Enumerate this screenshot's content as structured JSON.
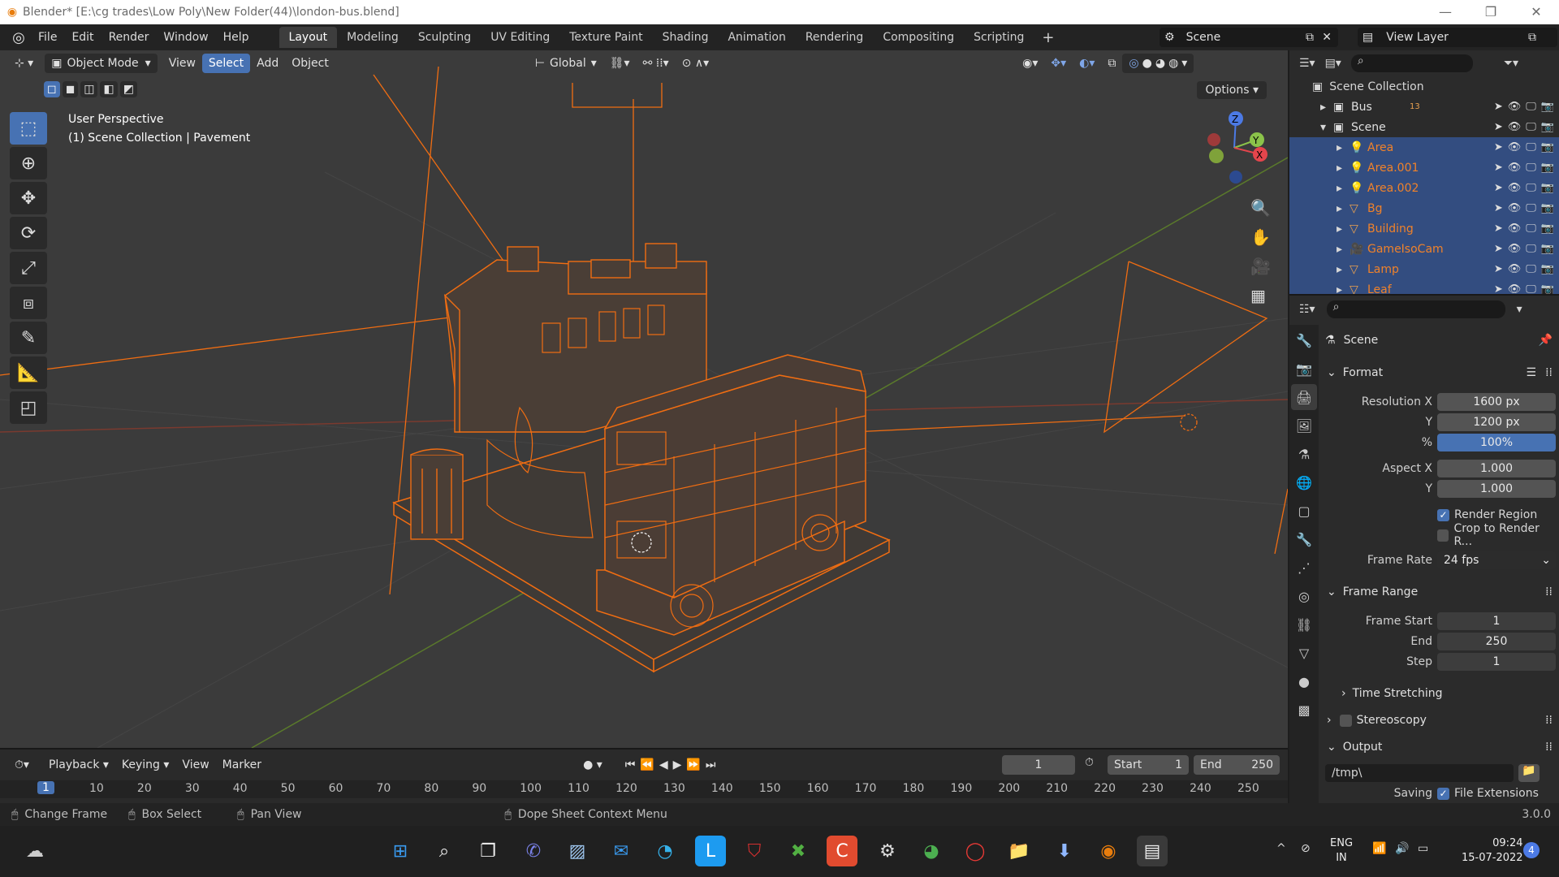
{
  "window": {
    "title": "Blender* [E:\\cg trades\\Low Poly\\New Folder(44)\\london-bus.blend]",
    "controls": [
      "—",
      "❐",
      "✕"
    ]
  },
  "menubar": {
    "menus": [
      "File",
      "Edit",
      "Render",
      "Window",
      "Help"
    ],
    "workspaces": [
      "Layout",
      "Modeling",
      "Sculpting",
      "UV Editing",
      "Texture Paint",
      "Shading",
      "Animation",
      "Rendering",
      "Compositing",
      "Scripting"
    ],
    "active_workspace": "Layout",
    "scene_name": "Scene",
    "view_layer": "View Layer"
  },
  "viewport": {
    "mode": "Object Mode",
    "menus": [
      "View",
      "Select",
      "Add",
      "Object"
    ],
    "selected_menu": "Select",
    "transform_orientation": "Global",
    "options_label": "Options",
    "info_line1": "User Perspective",
    "info_line2": "(1) Scene Collection | Pavement",
    "gizmo_axes": [
      "Z",
      "Y",
      "X"
    ],
    "wire_color": "#f06d12"
  },
  "timeline": {
    "menus": [
      "Playback",
      "Keying",
      "View",
      "Marker"
    ],
    "current_frame": "1",
    "start_label": "Start",
    "start_value": "1",
    "end_label": "End",
    "end_value": "250",
    "ruler": [
      "1",
      "10",
      "20",
      "30",
      "40",
      "50",
      "60",
      "70",
      "80",
      "90",
      "100",
      "110",
      "120",
      "130",
      "140",
      "150",
      "160",
      "170",
      "180",
      "190",
      "200",
      "210",
      "220",
      "230",
      "240",
      "250"
    ]
  },
  "statusbar": {
    "hints": [
      "Change Frame",
      "Box Select",
      "Pan View",
      "Dope Sheet Context Menu"
    ],
    "version": "3.0.0"
  },
  "outliner": {
    "root": "Scene Collection",
    "items": [
      {
        "name": "Bus",
        "type": "collection",
        "badge": "13"
      },
      {
        "name": "Scene",
        "type": "collection",
        "expanded": true
      },
      {
        "name": "Area",
        "type": "light"
      },
      {
        "name": "Area.001",
        "type": "light"
      },
      {
        "name": "Area.002",
        "type": "light"
      },
      {
        "name": "Bg",
        "type": "mesh"
      },
      {
        "name": "Building",
        "type": "mesh"
      },
      {
        "name": "GameIsoCam",
        "type": "camera"
      },
      {
        "name": "Lamp",
        "type": "mesh"
      },
      {
        "name": "Leaf",
        "type": "mesh"
      }
    ]
  },
  "properties": {
    "context": "Scene",
    "format": {
      "title": "Format",
      "resolution_x_label": "Resolution X",
      "resolution_x": "1600 px",
      "y_label": "Y",
      "resolution_y": "1200 px",
      "pct_label": "%",
      "resolution_pct": "100%",
      "aspect_x_label": "Aspect X",
      "aspect_x": "1.000",
      "aspect_y_label": "Y",
      "aspect_y": "1.000",
      "render_region": "Render Region",
      "crop": "Crop to Render R...",
      "frame_rate_label": "Frame Rate",
      "frame_rate": "24 fps"
    },
    "frame_range": {
      "title": "Frame Range",
      "start_label": "Frame Start",
      "start": "1",
      "end_label": "End",
      "end": "250",
      "step_label": "Step",
      "step": "1"
    },
    "time_stretching": "Time Stretching",
    "stereoscopy": "Stereoscopy",
    "output": {
      "title": "Output",
      "path": "/tmp\\",
      "saving_label": "Saving",
      "file_extensions": "File Extensions"
    }
  },
  "taskbar": {
    "lang1": "ENG",
    "lang2": "IN",
    "time": "09:24",
    "date": "15-07-2022",
    "notification_count": "4"
  }
}
